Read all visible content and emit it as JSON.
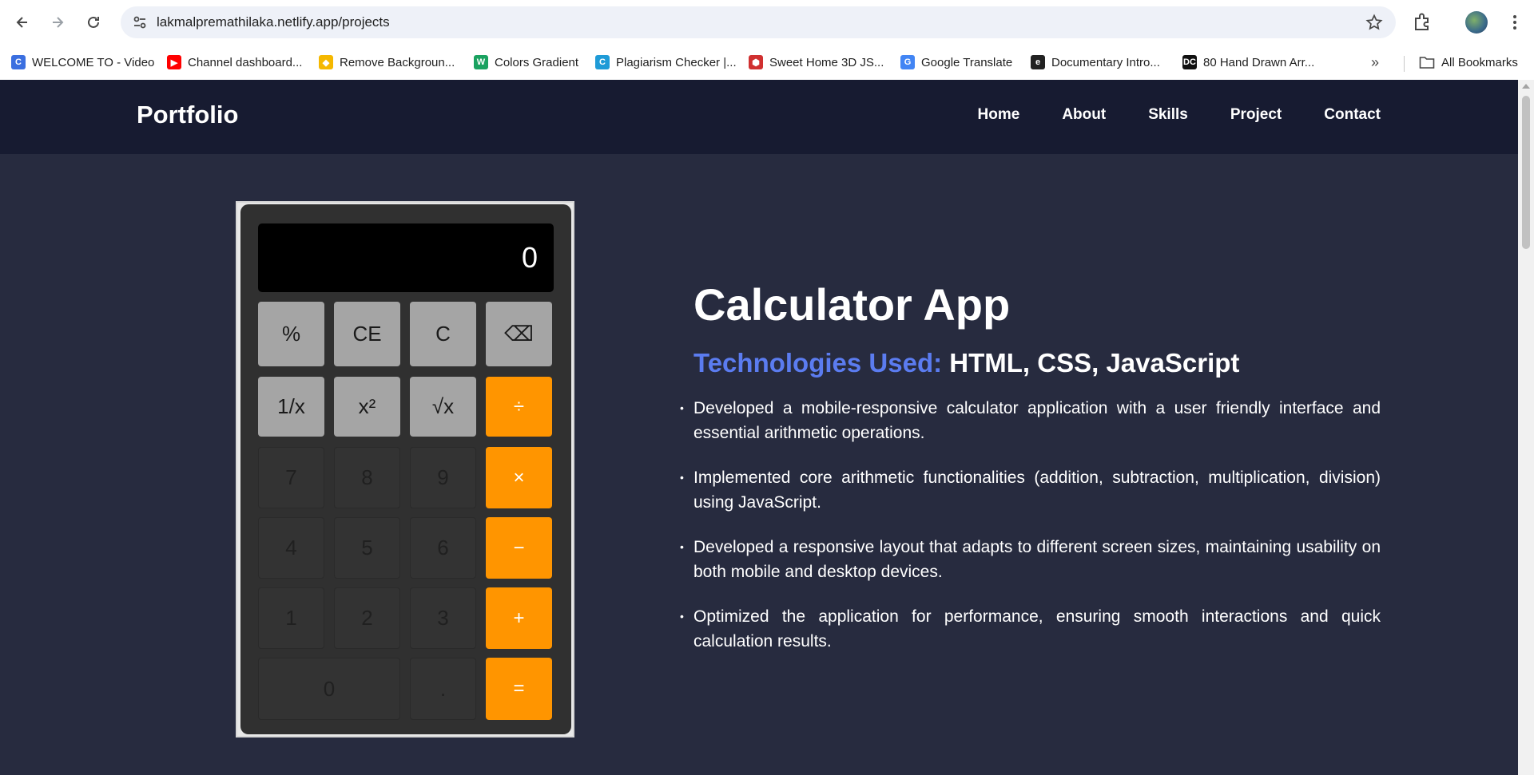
{
  "browser": {
    "url": "lakmalpremathilaka.netlify.app/projects",
    "bookmarks": [
      {
        "label": "WELCOME TO - Video",
        "color": "#3b6fe0",
        "glyph": "C"
      },
      {
        "label": "Channel dashboard...",
        "color": "#ff0000",
        "glyph": "▶"
      },
      {
        "label": "Remove Backgroun...",
        "color": "#f5b800",
        "glyph": "◆"
      },
      {
        "label": "Colors Gradient",
        "color": "#1aa260",
        "glyph": "W"
      },
      {
        "label": "Plagiarism Checker |...",
        "color": "#1f9bd7",
        "glyph": "C"
      },
      {
        "label": "Sweet Home 3D JS...",
        "color": "#d03030",
        "glyph": "⬢"
      },
      {
        "label": "Google Translate",
        "color": "#4285f4",
        "glyph": "G"
      },
      {
        "label": "Documentary Intro...",
        "color": "#222222",
        "glyph": "e"
      },
      {
        "label": "80 Hand Drawn Arr...",
        "color": "#111111",
        "glyph": "DC"
      }
    ],
    "more": "»",
    "all_bookmarks": "All Bookmarks"
  },
  "site": {
    "brand": "Portfolio",
    "nav": [
      "Home",
      "About",
      "Skills",
      "Project",
      "Contact"
    ]
  },
  "calculator": {
    "display": "0",
    "keys": [
      {
        "label": "%",
        "kind": "fn"
      },
      {
        "label": "CE",
        "kind": "fn"
      },
      {
        "label": "C",
        "kind": "fn"
      },
      {
        "label": "⌫",
        "kind": "fn"
      },
      {
        "label": "1/x",
        "kind": "fn"
      },
      {
        "label": "x²",
        "kind": "fn"
      },
      {
        "label": "√x",
        "kind": "fn"
      },
      {
        "label": "÷",
        "kind": "op"
      },
      {
        "label": "7",
        "kind": "num"
      },
      {
        "label": "8",
        "kind": "num"
      },
      {
        "label": "9",
        "kind": "num"
      },
      {
        "label": "×",
        "kind": "op"
      },
      {
        "label": "4",
        "kind": "num"
      },
      {
        "label": "5",
        "kind": "num"
      },
      {
        "label": "6",
        "kind": "num"
      },
      {
        "label": "−",
        "kind": "op"
      },
      {
        "label": "1",
        "kind": "num"
      },
      {
        "label": "2",
        "kind": "num"
      },
      {
        "label": "3",
        "kind": "num"
      },
      {
        "label": "+",
        "kind": "op"
      },
      {
        "label": "0",
        "kind": "num"
      },
      {
        "label": ".",
        "kind": "num"
      },
      {
        "label": "=",
        "kind": "op"
      }
    ]
  },
  "project": {
    "title": "Calculator App",
    "tech_label": "Technologies Used:",
    "tech_value": "HTML, CSS, JavaScript",
    "points": [
      "Developed a mobile-responsive calculator application with a user friendly interface and essential arithmetic operations.",
      "Implemented core arithmetic functionalities (addition, subtraction, multiplication, division) using JavaScript.",
      "Developed a responsive layout that adapts to different screen sizes, maintaining usability on both mobile and desktop devices.",
      "Optimized the application for performance, ensuring smooth interactions and quick calculation results."
    ]
  }
}
